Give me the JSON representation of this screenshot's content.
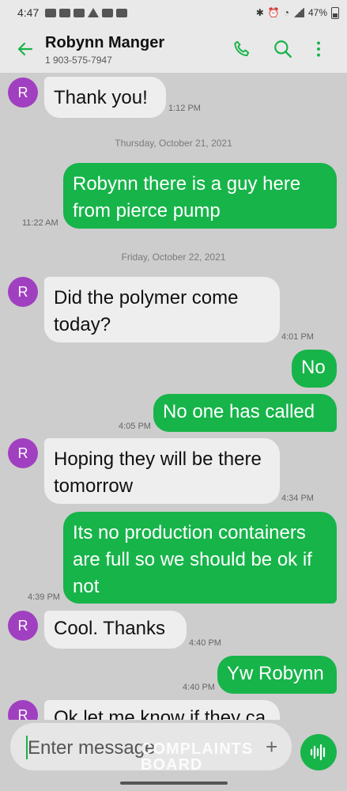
{
  "status": {
    "time": "4:47",
    "battery": "47%"
  },
  "header": {
    "contact_name": "Robynn Manger",
    "contact_phone": "1 903-575-7947",
    "accent": "#17b44a"
  },
  "avatar_initial": "R",
  "messages": [
    {
      "text": "Thank you!",
      "time": "1:12 PM"
    },
    {
      "day": "Thursday, October 21, 2021"
    },
    {
      "text": "Robynn there is a guy here from pierce pump",
      "time": "11:22 AM"
    },
    {
      "day": "Friday, October 22, 2021"
    },
    {
      "text": "Did the polymer come today?",
      "time": "4:01 PM"
    },
    {
      "text": "No"
    },
    {
      "text": "No one has called",
      "time": "4:05 PM"
    },
    {
      "text": "Hoping they will be there tomorrow",
      "time": "4:34 PM"
    },
    {
      "text": "Its no production containers are full so we should be ok if not",
      "time": "4:39 PM"
    },
    {
      "text": "Cool. Thanks",
      "time": "4:40 PM"
    },
    {
      "text": "Yw Robynn",
      "time": "4:40 PM"
    },
    {
      "text": "Ok let me know if they ca"
    }
  ],
  "composer": {
    "placeholder": "Enter message"
  },
  "watermark": {
    "line1": "COMPLAINTS",
    "line2": "BOARD"
  }
}
